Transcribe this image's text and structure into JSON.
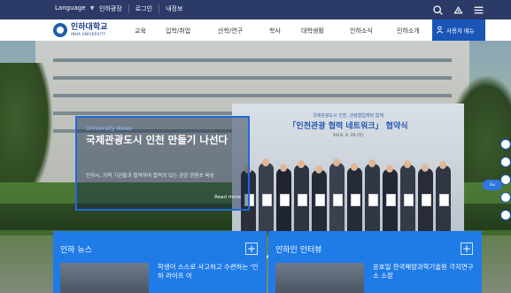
{
  "topbar": {
    "language": "Language",
    "links": [
      "인하광장",
      "로그인",
      "내정보"
    ]
  },
  "logo": {
    "name": "인하대학교",
    "eng": "INHA UNIVERSITY"
  },
  "nav": {
    "items": [
      "교육",
      "입학/취업",
      "산학/연구",
      "학사",
      "대학생활",
      "인하소식",
      "인하소개"
    ],
    "user_menu": "사용자 메뉴"
  },
  "hero": {
    "tag": "University News",
    "headline": "국제관광도시 인천 만들기 나선다",
    "desc": "인하시, 지역 기관들과 협약하여 협력의 있는 관광 콘텐츠 육성",
    "more": "Read more",
    "banner_sub": "국제관광도시 인천, 관광협업체와 함께",
    "banner_title": "「인천관광 협력 네트워크」 협약식",
    "banner_date": "2019. 9. 26.(목)",
    "side_label": "Gu",
    "slide_count": 5,
    "active_slide": 0
  },
  "panels": {
    "news": {
      "title": "인하 뉴스",
      "headline": "학생이 스스로 사고하고 수련하는 '인하 라이프 아"
    },
    "interview": {
      "title": "인하인 인터뷰",
      "headline": "윤호일 한국해양과학기술원 극지연구소 소장"
    }
  },
  "colors": {
    "topbar": "#2b3a67",
    "accent": "#1a56b7",
    "panel": "#1f7be6"
  }
}
